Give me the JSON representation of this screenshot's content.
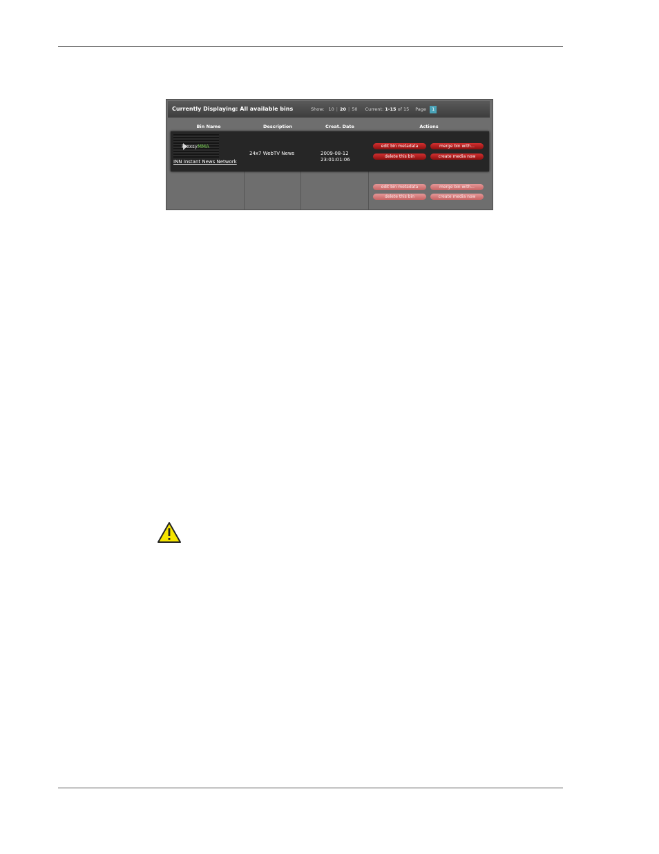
{
  "header": {
    "title": "Currently Displaying: All available bins",
    "show_label": "Show:",
    "show_options": [
      "10",
      "20",
      "50"
    ],
    "current_label": "Current:",
    "current_range": "1-15",
    "of_label": "of",
    "total": "15",
    "page_label": "Page",
    "page_number": "1"
  },
  "columns": [
    "Bin Name",
    "Description",
    "Creat. Date",
    "Actions"
  ],
  "rows": [
    {
      "thumbnail_logo": "Prexsy",
      "thumbnail_logo_accent": "MMA",
      "bin_name": "INN Instant News Network",
      "description": "24x7 WebTV News",
      "date": "2009-08-12",
      "time": "23:01:01:06"
    }
  ],
  "actions": {
    "edit": "edit bin metadata",
    "merge": "merge bin with...",
    "delete": "delete this bin",
    "create": "create media now"
  },
  "colors": {
    "button_active": "#b01c1c",
    "button_inactive": "#d98080",
    "page_highlight": "#4aa3b8",
    "warning_fill": "#f5e400"
  },
  "icons": {
    "warning": "warning-triangle-icon",
    "play": "play-icon"
  }
}
